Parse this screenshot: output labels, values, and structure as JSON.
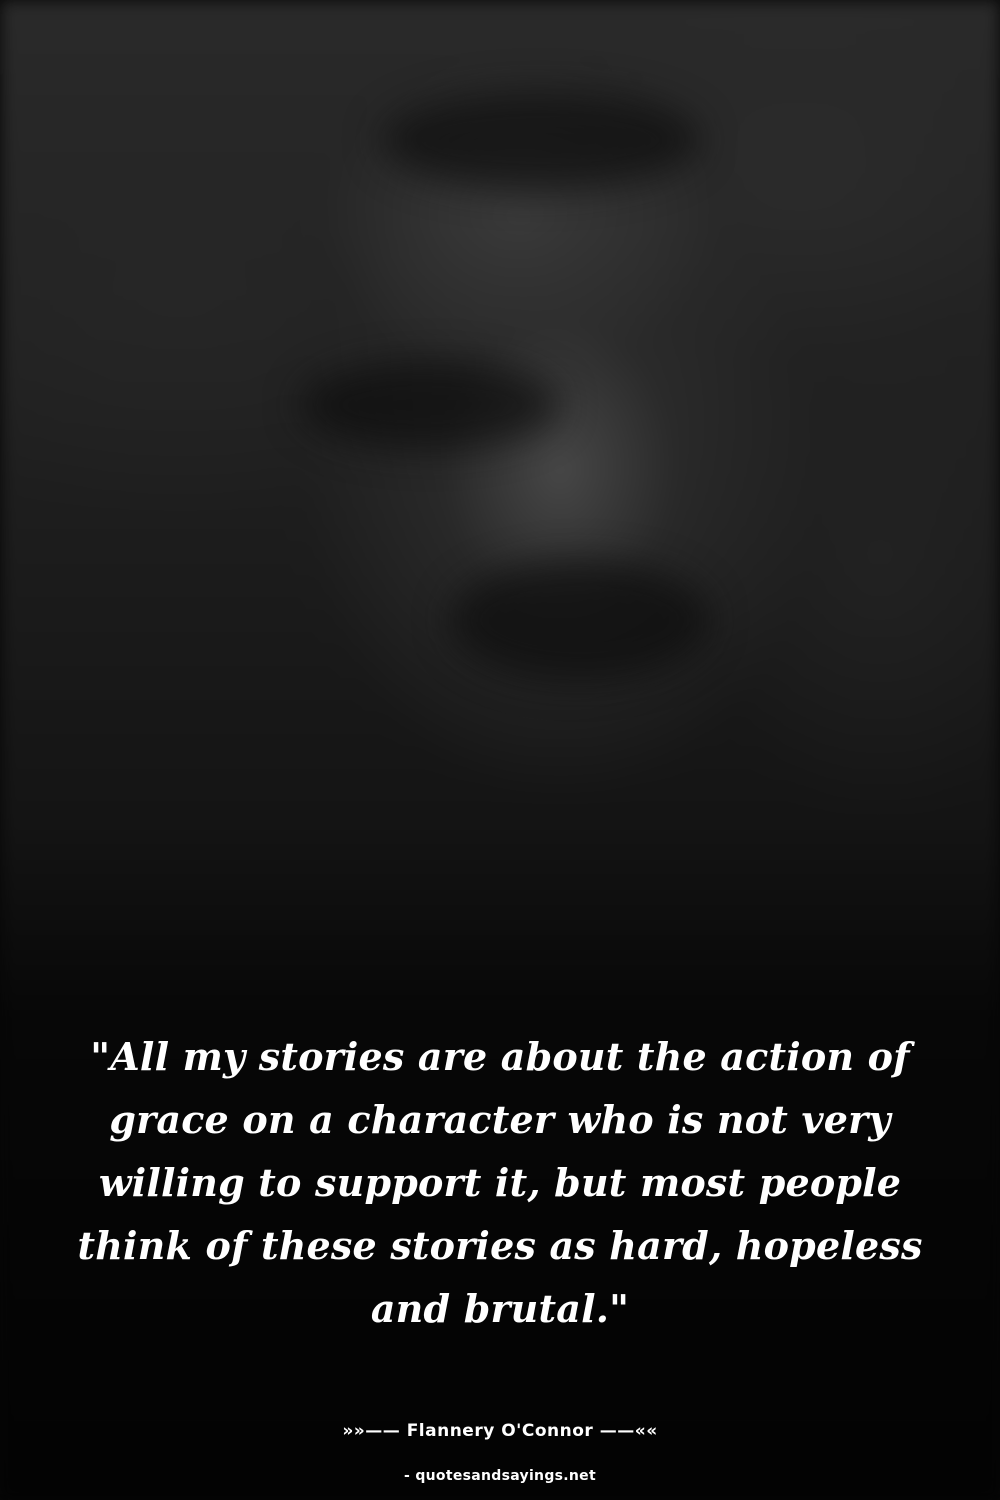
{
  "quote": {
    "text": "\"All my stories are about the action of grace on a character who is not very willing to support it, but most people think of these stories as hard, hopeless and brutal.\""
  },
  "author": {
    "text": "»»—— Flannery O'Connor ——««"
  },
  "source": {
    "text": "- quotesandsayings.net"
  },
  "colors": {
    "background": "#050505",
    "text": "#ffffff"
  }
}
